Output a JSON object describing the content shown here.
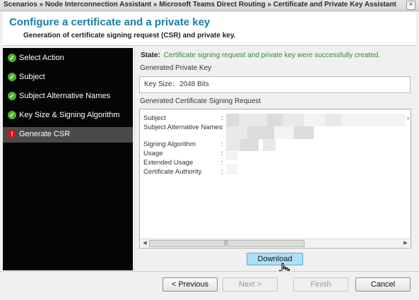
{
  "breadcrumb": "Scenarios » Node Interconnection Assistant » Microsoft Teams Direct Routing » Certificate and Private Key Assistant",
  "header": {
    "title": "Configure a certificate and a private key",
    "subtitle": "Generation of certificate signing request (CSR) and private key."
  },
  "steps": [
    {
      "label": "Select Action",
      "status": "done"
    },
    {
      "label": "Subject",
      "status": "done"
    },
    {
      "label": "Subject Alternative Names",
      "status": "done"
    },
    {
      "label": "Key Size & Signing Algorithm",
      "status": "done"
    },
    {
      "label": "Generate CSR",
      "status": "error",
      "active": true
    }
  ],
  "main": {
    "state_label": "State:",
    "state_message": "Certificate signing request and private key were successfully created.",
    "private_key_heading": "Generated Private Key",
    "key_size_label": "Key Size",
    "key_size_sep": ":",
    "key_size_value": "2048 Bits",
    "csr_heading": "Generated Certificate Signing Request",
    "csr_fields": [
      {
        "label": "Subject",
        "sep": ":"
      },
      {
        "label": "Subject Alternative Names",
        "sep": ":"
      },
      {
        "label": "Signing Algorithm",
        "sep": ":"
      },
      {
        "label": "Usage",
        "sep": ":"
      },
      {
        "label": "Extended Usage",
        "sep": ":"
      },
      {
        "label": "Certificate Authority",
        "sep": ":"
      }
    ],
    "download_label": "Download"
  },
  "footer": {
    "previous_label": "< Previous",
    "next_label": "Next >",
    "finish_label": "Finish",
    "cancel_label": "Cancel"
  },
  "colors": {
    "title": "#1a7ca8",
    "success": "#2e8b2e",
    "done_icon": "#4caf2a",
    "error_icon": "#d01515",
    "download_bg": "#aee0f5"
  },
  "icons": [
    "close-icon",
    "check-icon",
    "exclamation-icon",
    "hand-cursor-icon"
  ]
}
